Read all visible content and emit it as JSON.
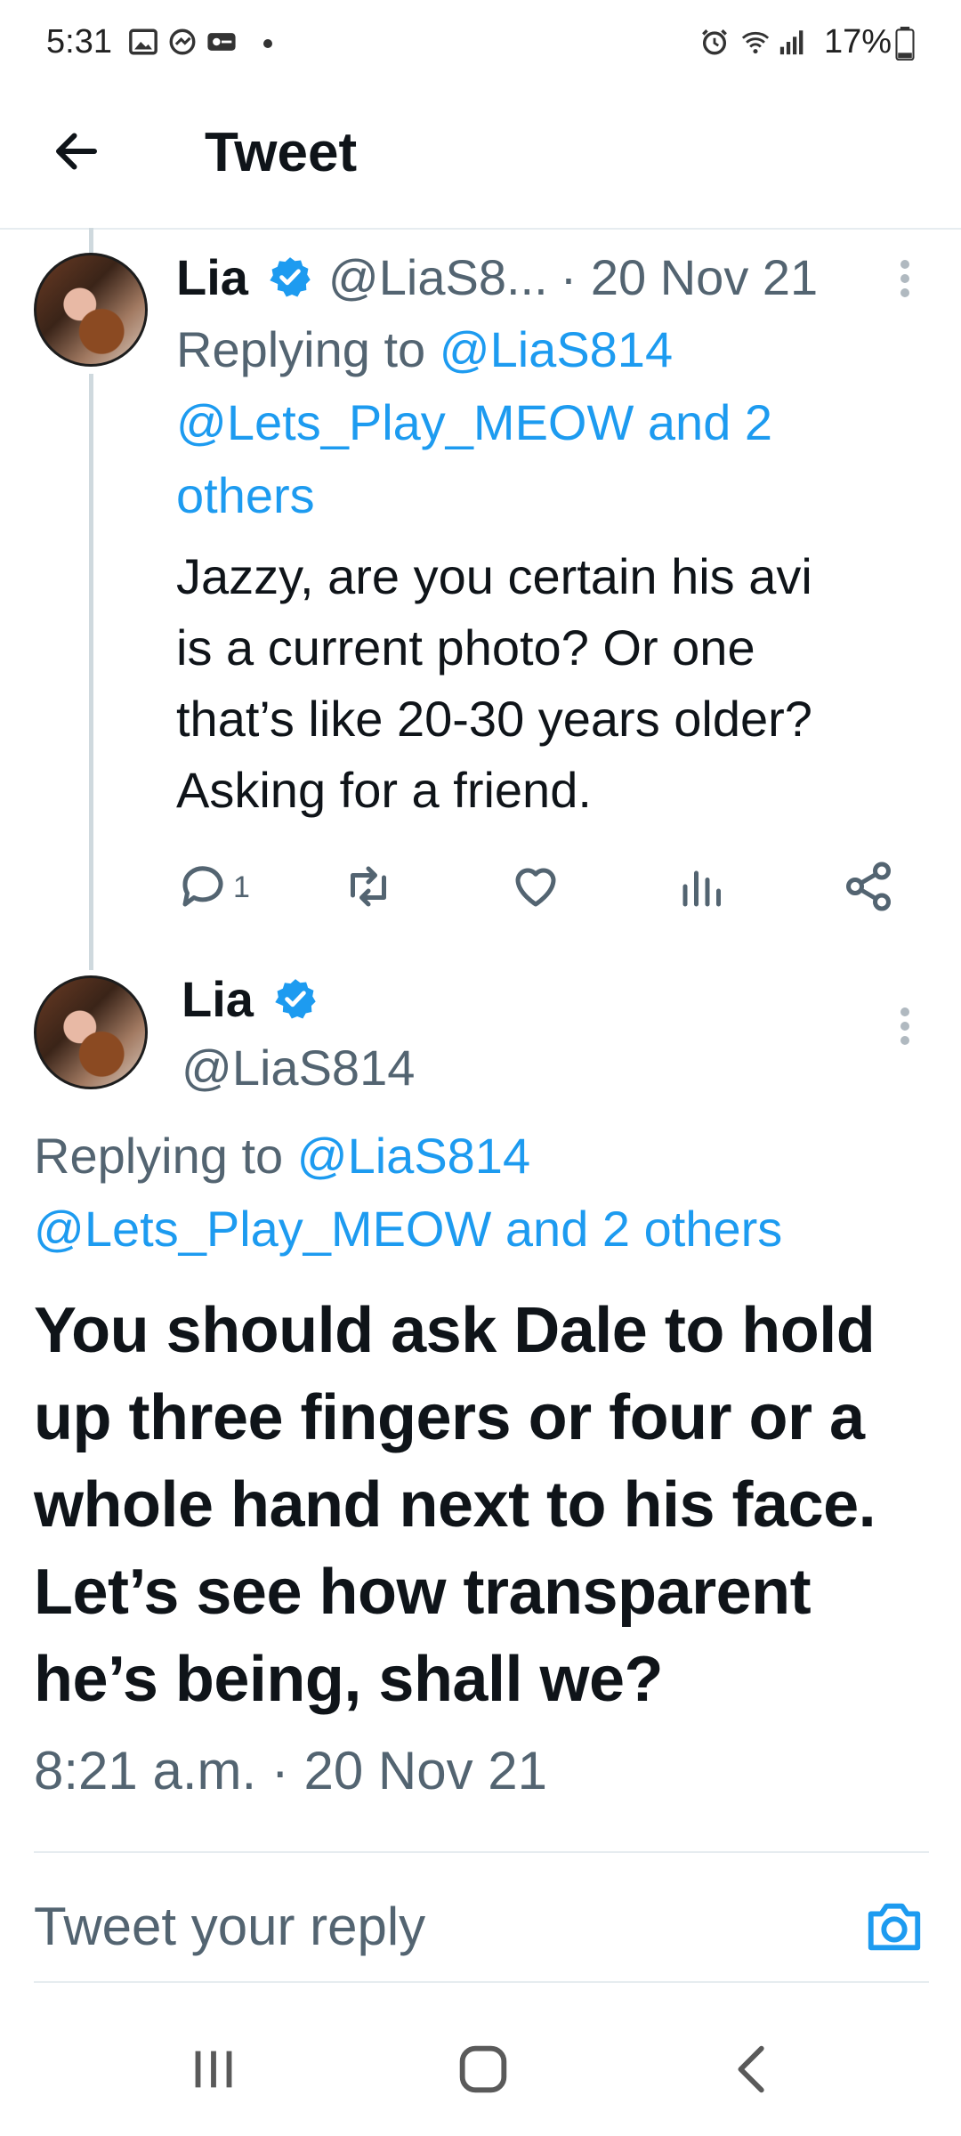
{
  "status_bar": {
    "time": "5:31",
    "battery": "17%"
  },
  "header": {
    "title": "Tweet"
  },
  "tweet1": {
    "author_name": "Lia",
    "handle_truncated": "@LiaS8...",
    "date": "· 20 Nov 21",
    "replying_to_label": "Replying to",
    "replying_to_1": "@LiaS814",
    "replying_to_2": "@Lets_Play_MEOW",
    "and_others": "and 2",
    "others": "others",
    "text_lines": [
      "Jazzy, are you certain his avi",
      "is a current photo? Or one",
      "that’s like 20-30 years older?",
      "Asking for a friend."
    ],
    "reply_count": "1"
  },
  "tweet2": {
    "author_name": "Lia",
    "handle": "@LiaS814",
    "replying_to_label": "Replying to",
    "replying_to_1": "@LiaS814",
    "replying_to_2": "@Lets_Play_MEOW",
    "and_others": "and 2 others",
    "text_lines": [
      "You should ask Dale to hold",
      "up three fingers or four or a",
      "whole hand next to his face.",
      "Let’s see how transparent",
      "he’s being, shall we?"
    ],
    "timestamp": "8:21 a.m. · 20 Nov 21"
  },
  "reply_bar": {
    "placeholder": "Tweet your reply"
  },
  "colors": {
    "accent": "#1d9bf0",
    "muted": "#536471",
    "text": "#0f1419"
  }
}
